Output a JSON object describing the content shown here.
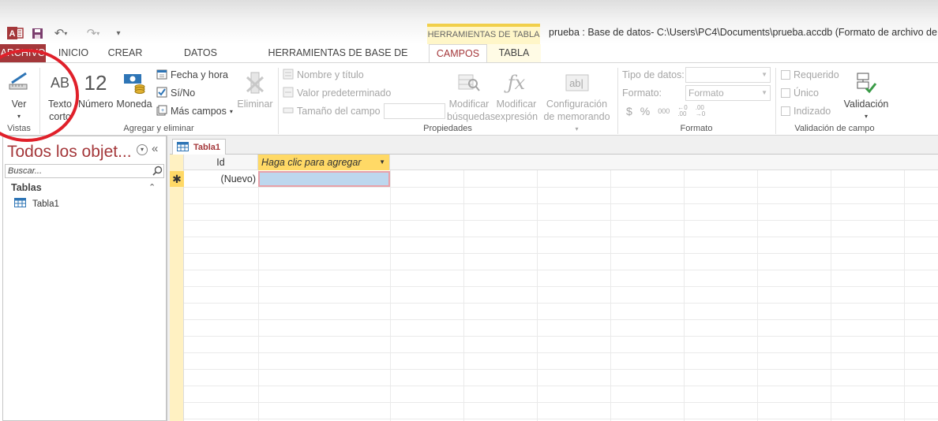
{
  "window": {
    "title": "prueba : Base de datos- C:\\Users\\PC4\\Documents\\prueba.accdb (Formato de archivo de Acce",
    "context_tab_header": "HERRAMIENTAS DE TABLA"
  },
  "tabs": [
    {
      "label": "ARCHIVO"
    },
    {
      "label": "INICIO"
    },
    {
      "label": "CREAR"
    },
    {
      "label": "DATOS EXTERNOS"
    },
    {
      "label": "HERRAMIENTAS DE BASE DE DATOS"
    },
    {
      "label": "CAMPOS"
    },
    {
      "label": "TABLA"
    }
  ],
  "ribbon": {
    "vistas": {
      "ver_label": "Ver",
      "group_label": "Vistas"
    },
    "agregar": {
      "texto_corto": "Texto corto",
      "numero": "Número",
      "numero_icon_text": "12",
      "texto_icon_text": "AB",
      "moneda": "Moneda",
      "fecha_hora": "Fecha y hora",
      "si_no": "Sí/No",
      "mas_campos": "Más campos",
      "eliminar": "Eliminar",
      "group_label": "Agregar y eliminar"
    },
    "propiedades": {
      "nombre_titulo": "Nombre y título",
      "valor_predeterminado": "Valor predeterminado",
      "tamano_campo": "Tamaño del campo",
      "modificar_busquedas": "Modificar búsquedas",
      "modificar_expresion": "Modificar expresión",
      "configuracion_memorando": "Configuración de memorando",
      "group_label": "Propiedades"
    },
    "formato": {
      "tipo_datos_label": "Tipo de datos:",
      "formato_label": "Formato:",
      "formato_value": "Formato",
      "group_label": "Formato"
    },
    "validacion": {
      "requerido": "Requerido",
      "unico": "Único",
      "indizado": "Indizado",
      "validacion": "Validación",
      "group_label": "Validación de campo"
    }
  },
  "nav_pane": {
    "title": "Todos los objet...",
    "search_placeholder": "Buscar...",
    "section": "Tablas",
    "items": [
      {
        "label": "Tabla1"
      }
    ]
  },
  "document": {
    "tab_label": "Tabla1",
    "columns": [
      {
        "label": "Id"
      },
      {
        "label": "Haga clic para agregar"
      }
    ],
    "new_row_id": "(Nuevo)"
  },
  "colors": {
    "accent": "#a4373a",
    "annotation": "#e0202a",
    "header_highlight": "#ffd966"
  }
}
